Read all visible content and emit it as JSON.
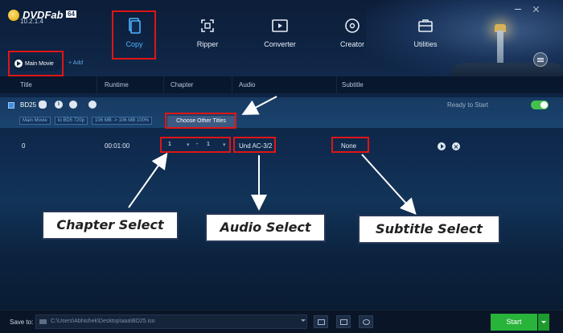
{
  "app": {
    "logo_text": "DVDFab",
    "logo_badge": "64",
    "version": "10.2.1.4"
  },
  "modules": [
    {
      "label": "Copy",
      "icon": "copy-icon",
      "active": true
    },
    {
      "label": "Ripper",
      "icon": "ripper-icon"
    },
    {
      "label": "Converter",
      "icon": "converter-icon"
    },
    {
      "label": "Creator",
      "icon": "creator-icon"
    },
    {
      "label": "Utilities",
      "icon": "utilities-icon"
    }
  ],
  "toolbar": {
    "main_movie_label": "Main Movie",
    "add_label": "+ Add"
  },
  "columns": [
    "Title",
    "Runtime",
    "Chapter",
    "Audio",
    "Subtitle"
  ],
  "title_item": {
    "name": "BD25",
    "info_icon": "i",
    "chips": [
      "Main Movie",
      "to BD5 720p",
      "106 MB -> 106 MB 100%"
    ],
    "status": "Ready to Start",
    "choose_other_titles": "Choose Other Titles"
  },
  "row": {
    "title": "0",
    "runtime": "00:01:00",
    "chapter_start": "1",
    "chapter_end": "1",
    "chapter_sep": "-",
    "audio": "Und AC-3/2",
    "subtitle": "None"
  },
  "annotations": {
    "chapter": "Chapter Select",
    "audio": "Audio Select",
    "subtitle": "Subtitle Select",
    "highlight_color": "#e01515"
  },
  "bottom": {
    "save_to_label": "Save to:",
    "path": "C:\\Users\\Abhishek\\Desktop\\aaa\\BD25.iso",
    "start_label": "Start",
    "start_color": "#28b33a"
  }
}
